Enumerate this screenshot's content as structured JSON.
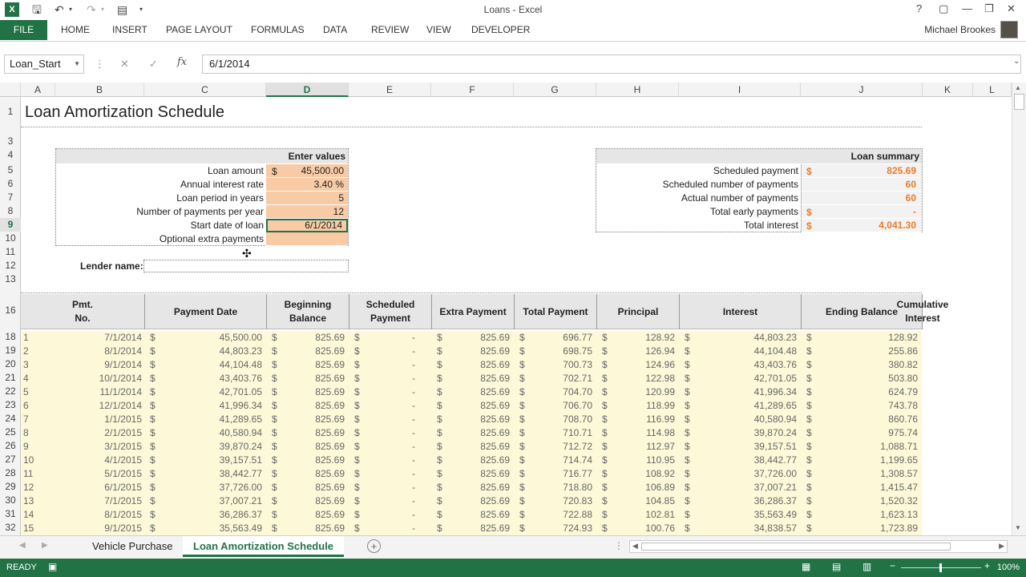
{
  "window": {
    "title": "Loans - Excel",
    "controls": [
      "?",
      "▢",
      "—",
      "❐",
      "✕"
    ]
  },
  "ribbon": {
    "file": "FILE",
    "tabs": [
      "HOME",
      "INSERT",
      "PAGE LAYOUT",
      "FORMULAS",
      "DATA",
      "REVIEW",
      "VIEW",
      "DEVELOPER"
    ],
    "user": "Michael Brookes"
  },
  "formula_bar": {
    "name_box": "Loan_Start",
    "fx": "fx",
    "formula": "6/1/2014"
  },
  "columns": [
    "A",
    "B",
    "C",
    "D",
    "E",
    "F",
    "G",
    "H",
    "I",
    "J",
    "K",
    "L"
  ],
  "selected_column": "D",
  "row_numbers": [
    "1",
    "3",
    "4",
    "5",
    "6",
    "7",
    "8",
    "9",
    "10",
    "11",
    "12",
    "13",
    "16",
    "18",
    "19",
    "20",
    "21",
    "22",
    "23",
    "24",
    "25",
    "26",
    "27",
    "28",
    "29",
    "30",
    "31",
    "32"
  ],
  "selected_row": "9",
  "sheet_title": "Loan Amortization Schedule",
  "inputs": {
    "header": "Enter values",
    "rows": [
      {
        "label": "Loan amount",
        "prefix": "$",
        "value": "45,500.00"
      },
      {
        "label": "Annual interest rate",
        "prefix": "",
        "value": "3.40  %"
      },
      {
        "label": "Loan period in years",
        "prefix": "",
        "value": "5"
      },
      {
        "label": "Number of payments per year",
        "prefix": "",
        "value": "12"
      },
      {
        "label": "Start date of loan",
        "prefix": "",
        "value": "6/1/2014"
      },
      {
        "label": "Optional extra payments",
        "prefix": "",
        "value": ""
      }
    ]
  },
  "lender": {
    "label": "Lender name:",
    "value": ""
  },
  "summary": {
    "header": "Loan summary",
    "rows": [
      {
        "label": "Scheduled payment",
        "prefix": "$",
        "value": "825.69"
      },
      {
        "label": "Scheduled number of payments",
        "prefix": "",
        "value": "60"
      },
      {
        "label": "Actual number of payments",
        "prefix": "",
        "value": "60"
      },
      {
        "label": "Total early payments",
        "prefix": "$",
        "value": "-"
      },
      {
        "label": "Total interest",
        "prefix": "$",
        "value": "4,041.30"
      }
    ]
  },
  "table": {
    "headers": [
      "Pmt.\nNo.",
      "Payment Date",
      "Beginning Balance",
      "Scheduled\nPayment",
      "Extra Payment",
      "Total Payment",
      "Principal",
      "Interest",
      "Ending Balance",
      "Cumulative Interest"
    ],
    "currency": "$",
    "rows": [
      [
        "1",
        "7/1/2014",
        "45,500.00",
        "825.69",
        "-",
        "825.69",
        "696.77",
        "128.92",
        "44,803.23",
        "128.92"
      ],
      [
        "2",
        "8/1/2014",
        "44,803.23",
        "825.69",
        "-",
        "825.69",
        "698.75",
        "126.94",
        "44,104.48",
        "255.86"
      ],
      [
        "3",
        "9/1/2014",
        "44,104.48",
        "825.69",
        "-",
        "825.69",
        "700.73",
        "124.96",
        "43,403.76",
        "380.82"
      ],
      [
        "4",
        "10/1/2014",
        "43,403.76",
        "825.69",
        "-",
        "825.69",
        "702.71",
        "122.98",
        "42,701.05",
        "503.80"
      ],
      [
        "5",
        "11/1/2014",
        "42,701.05",
        "825.69",
        "-",
        "825.69",
        "704.70",
        "120.99",
        "41,996.34",
        "624.79"
      ],
      [
        "6",
        "12/1/2014",
        "41,996.34",
        "825.69",
        "-",
        "825.69",
        "706.70",
        "118.99",
        "41,289.65",
        "743.78"
      ],
      [
        "7",
        "1/1/2015",
        "41,289.65",
        "825.69",
        "-",
        "825.69",
        "708.70",
        "116.99",
        "40,580.94",
        "860.76"
      ],
      [
        "8",
        "2/1/2015",
        "40,580.94",
        "825.69",
        "-",
        "825.69",
        "710.71",
        "114.98",
        "39,870.24",
        "975.74"
      ],
      [
        "9",
        "3/1/2015",
        "39,870.24",
        "825.69",
        "-",
        "825.69",
        "712.72",
        "112.97",
        "39,157.51",
        "1,088.71"
      ],
      [
        "10",
        "4/1/2015",
        "39,157.51",
        "825.69",
        "-",
        "825.69",
        "714.74",
        "110.95",
        "38,442.77",
        "1,199.65"
      ],
      [
        "11",
        "5/1/2015",
        "38,442.77",
        "825.69",
        "-",
        "825.69",
        "716.77",
        "108.92",
        "37,726.00",
        "1,308.57"
      ],
      [
        "12",
        "6/1/2015",
        "37,726.00",
        "825.69",
        "-",
        "825.69",
        "718.80",
        "106.89",
        "37,007.21",
        "1,415.47"
      ],
      [
        "13",
        "7/1/2015",
        "37,007.21",
        "825.69",
        "-",
        "825.69",
        "720.83",
        "104.85",
        "36,286.37",
        "1,520.32"
      ],
      [
        "14",
        "8/1/2015",
        "36,286.37",
        "825.69",
        "-",
        "825.69",
        "722.88",
        "102.81",
        "35,563.49",
        "1,623.13"
      ],
      [
        "15",
        "9/1/2015",
        "35,563.49",
        "825.69",
        "-",
        "825.69",
        "724.93",
        "100.76",
        "34,838.57",
        "1,723.89"
      ]
    ]
  },
  "sheet_tabs": [
    "Vehicle Purchase",
    "Loan Amortization Schedule"
  ],
  "active_sheet": "Loan Amortization Schedule",
  "status": {
    "ready": "READY",
    "zoom": "100%"
  },
  "colors": {
    "excel_green": "#217346",
    "input_fill": "#f8cba5",
    "summary_value": "#e87d2b",
    "row_fill": "#fdf9d8"
  }
}
